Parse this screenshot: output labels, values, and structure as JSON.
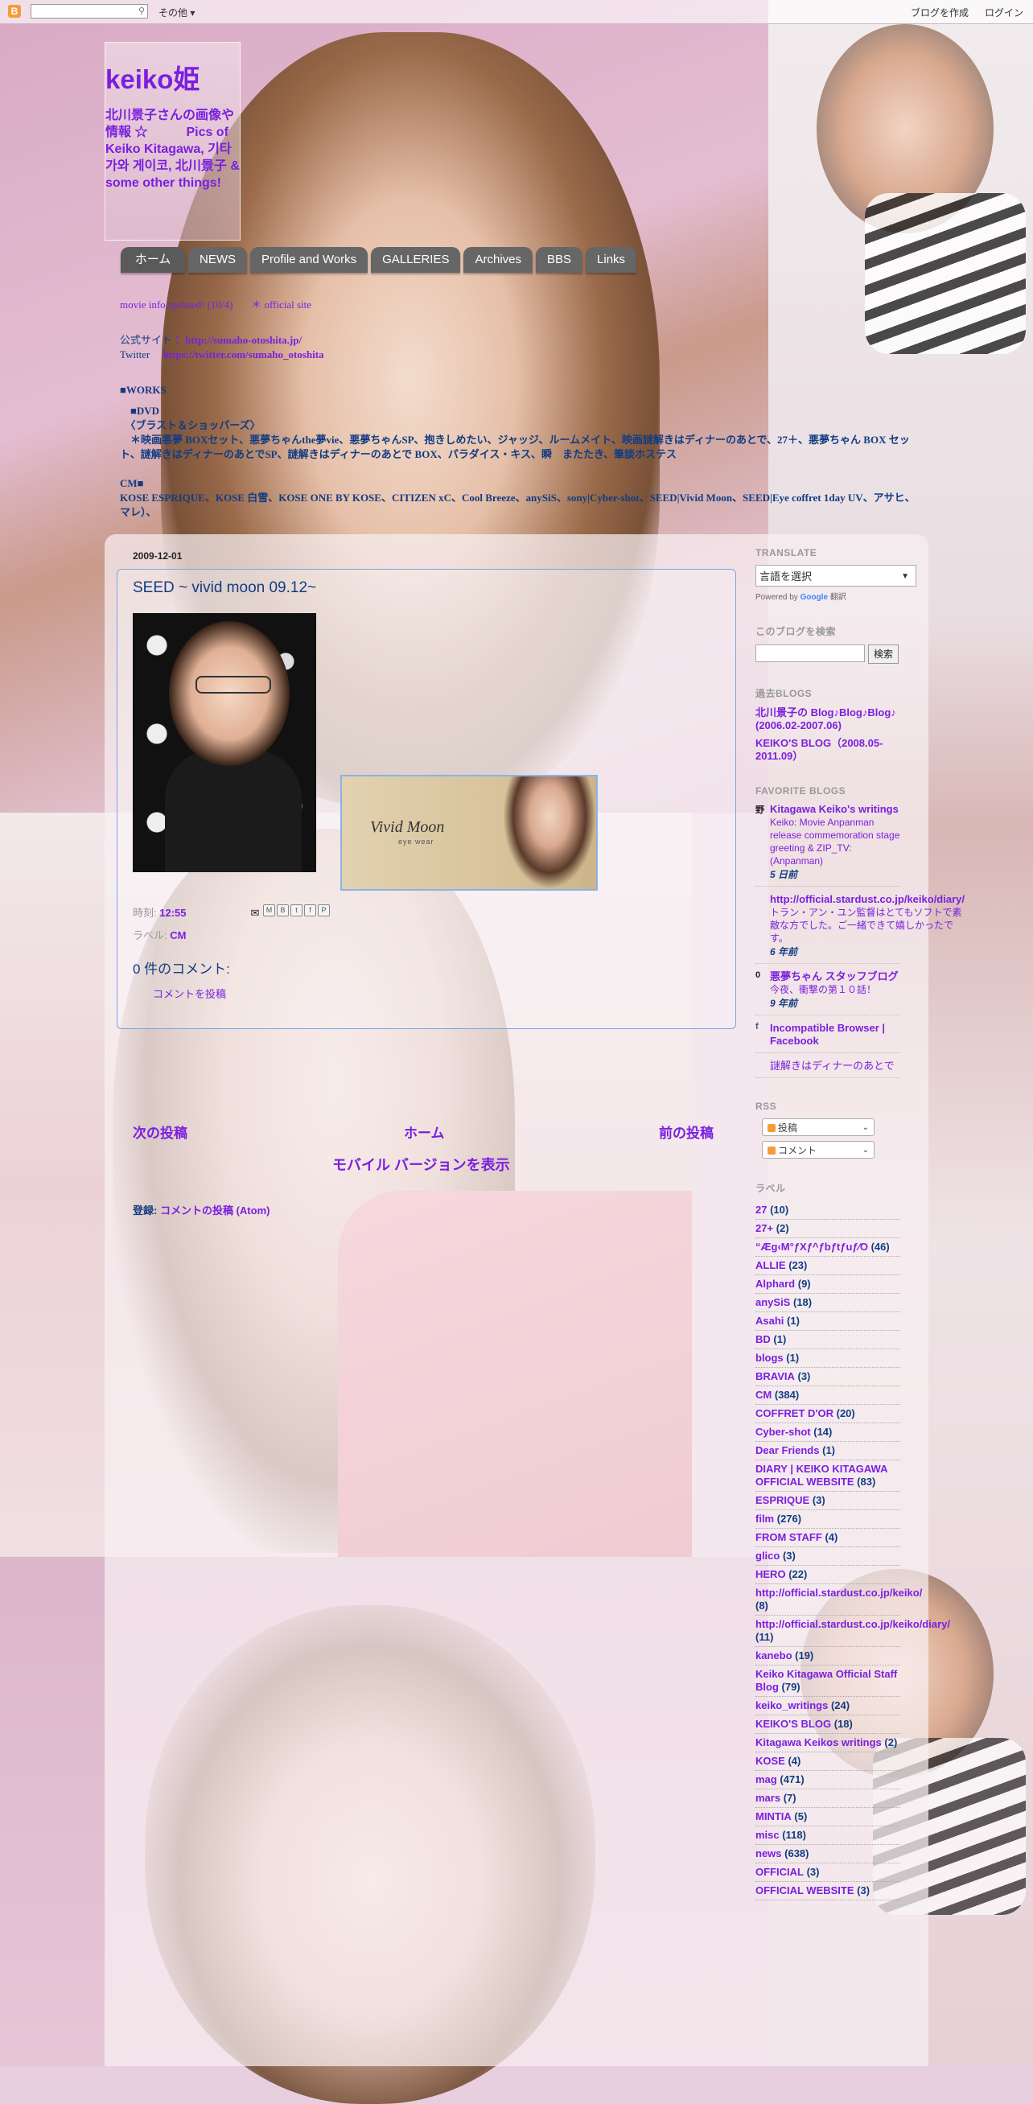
{
  "topbar": {
    "more_label": "その他",
    "create_blog": "ブログを作成",
    "login": "ログイン"
  },
  "blog": {
    "title": "keiko姫",
    "description": "北川景子さんの画像や情報 ☆　　　Pics of Keiko Kitagawa, 기타가와 게이코, 北川景子 & some other things!"
  },
  "tabs": [
    "ホーム",
    "NEWS",
    "Profile and Works",
    "Archives",
    "BBS",
    "Links",
    "GALLERIES"
  ],
  "info": {
    "line1_a": "movie info updated! (10/4)",
    "line1_b": "＊ official site",
    "line2_label": "公式サイト",
    "line2_url": "：http://sumaho-otoshita.jp/",
    "line3_label": "Twitter",
    "line3_url": "https://twitter.com/sumaho_otoshita",
    "line4": "■WORKS",
    "line5": "　■DVD",
    "line6": "　〈ブラスト＆ショッパーズ〉",
    "line7": "　＊映画悪夢 BOXセット、悪夢ちゃんthe夢vie、悪夢ちゃんSP、抱きしめたい、ジャッジ、ルームメイト、映画謎解きはディナーのあとで、27＋、悪夢ちゃん BOX セット、謎解きはディナーのあとでSP、謎解きはディナーのあとで BOX、パラダイス・キス、瞬　またたき、筆談ホステス",
    "line8": "CM■",
    "line9": "KOSE ESPRIQUE、KOSE 白雪、KOSE ONE BY KOSE、CITIZEN xC、Cool Breeze、anySiS、sony|Cyber-shot、SEED|Vivid Moon、SEED|Eye coffret 1day UV、アサヒ、マレ）、"
  },
  "post": {
    "date": "2009-12-01",
    "title": "SEED ~ vivid moon 09.12~",
    "photo2_logo": "Vivid Moon",
    "photo2_sub": "eye wear",
    "time_label": "時刻:",
    "time": "12:55",
    "labels_label": "ラベル:",
    "label": "CM",
    "comments_heading": "0 件のコメント:",
    "post_comment": "コメントを投稿"
  },
  "pager": {
    "newer": "次の投稿",
    "home": "ホーム",
    "older": "前の投稿",
    "mobile": "モバイル バージョンを表示"
  },
  "subscribe": {
    "label": "登録:",
    "link": "コメントの投稿 (Atom)"
  },
  "sidebar": {
    "translate_title": "TRANSLATE",
    "translate_select": "言語を選択",
    "powered_by": "Powered by",
    "google": "Google",
    "translate_word": "翻訳",
    "search_title": "このブログを検索",
    "search_button": "検索",
    "past_blogs_title": "過去BLOGS",
    "past_blogs": [
      "北川景子の Blog♪Blog♪Blog♪ (2006.02-2007.06)",
      "KEIKO'S BLOG（2008.05-2011.09）"
    ],
    "fav_title": "FAVORITE BLOGS",
    "favorites": [
      {
        "icon": "野",
        "title": "Kitagawa Keiko's writings",
        "sub": "Keiko: Movie Anpanman release commemoration stage greeting & ZIP_TV: (Anpanman)",
        "when": "5 日前"
      },
      {
        "icon": "",
        "title": "http://official.stardust.co.jp/keiko/diary/",
        "sub": "トラン・アン・ユン監督はとてもソフトで素敵な方でした。ご一緒できて嬉しかったです。",
        "when": "6 年前"
      },
      {
        "icon": "0",
        "title": "悪夢ちゃん スタッフブログ",
        "sub": "今夜、衝撃の第１０話！",
        "when": "9 年前"
      },
      {
        "icon": "f",
        "title": "Incompatible Browser | Facebook",
        "sub": "",
        "when": ""
      },
      {
        "icon": "",
        "title": "謎解きはディナーのあとで",
        "sub": "",
        "when": ""
      }
    ],
    "rss_title": "RSS",
    "rss_posts": "投稿",
    "rss_comments": "コメント",
    "labels_title": "ラベル",
    "labels": [
      {
        "name": "27",
        "count": "(10)"
      },
      {
        "name": "27+",
        "count": "(2)"
      },
      {
        "name": "“Æ­g‹M°ƒXƒ^ƒbƒtƒuƒ⁄O",
        "count": "(46)"
      },
      {
        "name": "ALLIE",
        "count": "(23)"
      },
      {
        "name": "Alphard",
        "count": "(9)"
      },
      {
        "name": "anySiS",
        "count": "(18)"
      },
      {
        "name": "Asahi",
        "count": "(1)"
      },
      {
        "name": "BD",
        "count": "(1)"
      },
      {
        "name": "blogs",
        "count": "(1)"
      },
      {
        "name": "BRAVIA",
        "count": "(3)"
      },
      {
        "name": "CM",
        "count": "(384)"
      },
      {
        "name": "COFFRET D'OR",
        "count": "(20)"
      },
      {
        "name": "Cyber-shot",
        "count": "(14)"
      },
      {
        "name": "Dear Friends",
        "count": "(1)"
      },
      {
        "name": "DIARY | KEIKO KITAGAWA OFFICIAL WEBSITE",
        "count": "(83)"
      },
      {
        "name": "ESPRIQUE",
        "count": "(3)"
      },
      {
        "name": "film",
        "count": "(276)"
      },
      {
        "name": "FROM STAFF",
        "count": "(4)"
      },
      {
        "name": "glico",
        "count": "(3)"
      },
      {
        "name": "HERO",
        "count": "(22)"
      },
      {
        "name": "http://official.stardust.co.jp/keiko/",
        "count": "(8)"
      },
      {
        "name": "http://official.stardust.co.jp/keiko/diary/",
        "count": "(11)"
      },
      {
        "name": "kanebo",
        "count": "(19)"
      },
      {
        "name": "Keiko Kitagawa Official Staff Blog",
        "count": "(79)"
      },
      {
        "name": "keiko_writings",
        "count": "(24)"
      },
      {
        "name": "KEIKO'S BLOG",
        "count": "(18)"
      },
      {
        "name": "Kitagawa Keikos writings",
        "count": "(2)"
      },
      {
        "name": "KOSE",
        "count": "(4)"
      },
      {
        "name": "mag",
        "count": "(471)"
      },
      {
        "name": "mars",
        "count": "(7)"
      },
      {
        "name": "MINTIA",
        "count": "(5)"
      },
      {
        "name": "misc",
        "count": "(118)"
      },
      {
        "name": "news",
        "count": "(638)"
      },
      {
        "name": "OFFICIAL",
        "count": "(3)"
      },
      {
        "name": "OFFICIAL WEBSITE",
        "count": "(3)"
      }
    ]
  }
}
